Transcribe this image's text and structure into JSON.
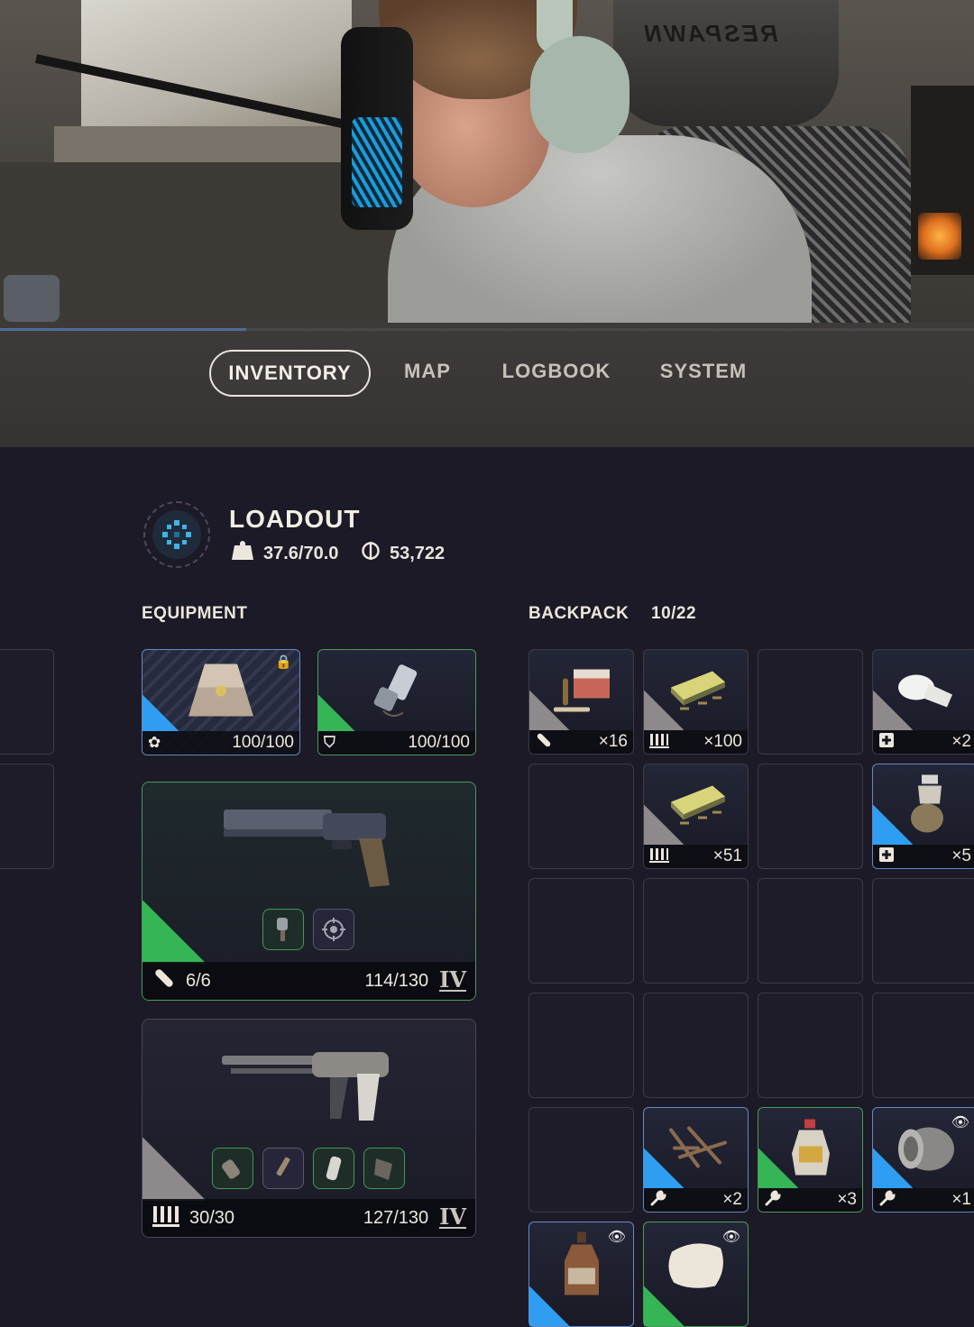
{
  "webcam": {
    "chair_brand": "RESPAWN",
    "playback_progress": 0.253
  },
  "tabs": [
    {
      "label": "INVENTORY",
      "active": true
    },
    {
      "label": "MAP",
      "active": false
    },
    {
      "label": "LOGBOOK",
      "active": false
    },
    {
      "label": "SYSTEM",
      "active": false
    }
  ],
  "loadout": {
    "title": "LOADOUT",
    "weight": "37.6/70.0",
    "currency": "53,722"
  },
  "equipment": {
    "label": "EQUIPMENT",
    "augment": {
      "durability": "100/100",
      "icon": "augment-icon",
      "locked": true
    },
    "shield": {
      "durability": "100/100",
      "icon": "shield-icon"
    },
    "weapon1": {
      "ammo": "6/6",
      "durability": "114/130",
      "tier": "IV",
      "ammo_icon": "bullet-icon",
      "attachments": [
        "muzzle-attachment",
        "scope-attachment"
      ]
    },
    "weapon2": {
      "ammo": "30/30",
      "durability": "127/130",
      "tier": "IV",
      "ammo_icon": "magazine-icon",
      "attachments": [
        "grip-attachment",
        "barrel-attachment",
        "stock-attachment",
        "mag-attachment"
      ]
    }
  },
  "backpack": {
    "label": "BACKPACK",
    "capacity": "10/22",
    "slots": [
      {
        "item": "ammo-box-heavy",
        "qty": "×16",
        "type_icon": "bullet-icon",
        "rarity": "grey"
      },
      {
        "item": "ammo-box-light",
        "qty": "×100",
        "type_icon": "magazine-icon",
        "rarity": "grey"
      },
      {
        "item": "",
        "qty": "",
        "type_icon": "",
        "rarity": "empty"
      },
      {
        "item": "bandage",
        "qty": "×2",
        "type_icon": "medical-icon",
        "rarity": "grey"
      },
      {
        "item": "",
        "qty": "",
        "type_icon": "",
        "rarity": "empty"
      },
      {
        "item": "ammo-box-light",
        "qty": "×51",
        "type_icon": "magazine-icon",
        "rarity": "grey"
      },
      {
        "item": "",
        "qty": "",
        "type_icon": "",
        "rarity": "empty"
      },
      {
        "item": "stim-injector",
        "qty": "×5",
        "type_icon": "medical-icon",
        "rarity": "blue"
      },
      {
        "item": "",
        "qty": "",
        "type_icon": "",
        "rarity": "empty"
      },
      {
        "item": "",
        "qty": "",
        "type_icon": "",
        "rarity": "empty"
      },
      {
        "item": "",
        "qty": "",
        "type_icon": "",
        "rarity": "empty"
      },
      {
        "item": "",
        "qty": "",
        "type_icon": "",
        "rarity": "empty"
      },
      {
        "item": "",
        "qty": "",
        "type_icon": "",
        "rarity": "empty"
      },
      {
        "item": "",
        "qty": "",
        "type_icon": "",
        "rarity": "empty"
      },
      {
        "item": "",
        "qty": "",
        "type_icon": "",
        "rarity": "empty"
      },
      {
        "item": "",
        "qty": "",
        "type_icon": "",
        "rarity": "empty"
      },
      {
        "item": "",
        "qty": "",
        "type_icon": "",
        "rarity": "empty"
      },
      {
        "item": "scrap-parts",
        "qty": "×2",
        "type_icon": "wrench-icon",
        "rarity": "blue"
      },
      {
        "item": "chemical-bottle",
        "qty": "×3",
        "type_icon": "wrench-icon",
        "rarity": "green"
      },
      {
        "item": "canister",
        "qty": "×1",
        "type_icon": "wrench-icon",
        "rarity": "blue",
        "watched": true
      },
      {
        "item": "glass-jug",
        "qty": "",
        "type_icon": "",
        "rarity": "blue",
        "watched": true
      },
      {
        "item": "cloth-sack",
        "qty": "",
        "type_icon": "",
        "rarity": "green",
        "watched": true
      }
    ]
  },
  "colors": {
    "rarity_blue": "#2f9ef0",
    "rarity_green": "#35b556",
    "rarity_grey": "#8e8a8c",
    "background": "#1c1a26"
  }
}
